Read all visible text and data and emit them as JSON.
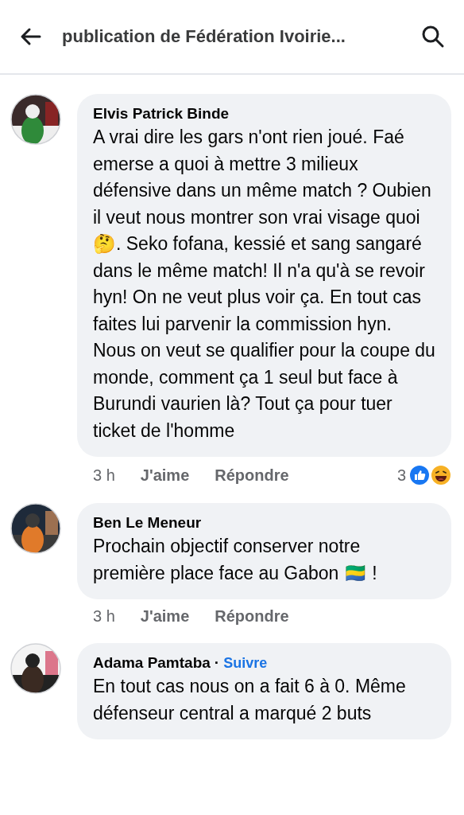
{
  "header": {
    "title": "publication de Fédération Ivoirie..."
  },
  "comments": [
    {
      "author": "Elvis Patrick Binde",
      "text": "A vrai dire les gars n'ont rien joué. Faé emerse a quoi à mettre 3 milieux défensive dans un même match ? Oubien il veut nous montrer son vrai visage quoi🤔. Seko fofana, kessié et sang sangaré dans le même match! Il n'a qu'à se revoir hyn! On ne veut plus voir ça. En tout cas faites lui parvenir la commission hyn. Nous on veut se qualifier pour la coupe du monde, comment ça 1 seul but face à Burundi vaurien là? Tout ça pour tuer ticket de l'homme",
      "time": "3 h",
      "like": "J'aime",
      "reply": "Répondre",
      "reactions": {
        "count": "3",
        "icons": [
          {
            "kind": "like"
          },
          {
            "kind": "haha"
          }
        ]
      }
    },
    {
      "author": "Ben Le Meneur",
      "text": "Prochain objectif conserver notre première place face au Gabon 🇬🇦 !",
      "time": "3 h",
      "like": "J'aime",
      "reply": "Répondre"
    },
    {
      "author": "Adama Pamtaba",
      "separator": "·",
      "follow": "Suivre",
      "text": "En tout cas nous on a fait 6 à 0. Même défenseur central a marqué 2 buts"
    }
  ]
}
